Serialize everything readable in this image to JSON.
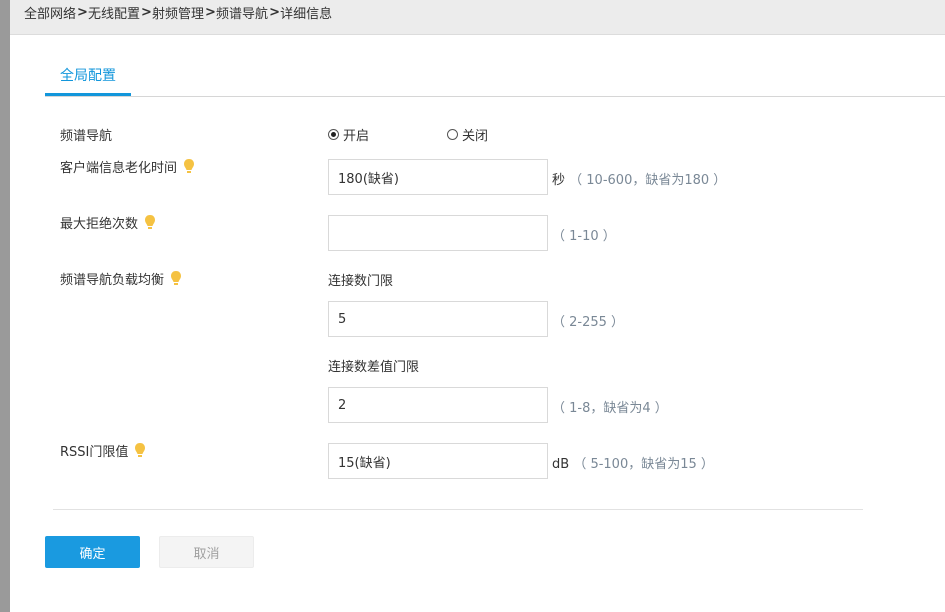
{
  "breadcrumb": {
    "items": [
      "全部网络",
      "无线配置",
      "射频管理",
      "频谱导航",
      "详细信息"
    ],
    "separator": ">"
  },
  "tabs": {
    "active": "全局配置"
  },
  "form": {
    "spectrum_nav": {
      "label": "频谱导航",
      "options": [
        {
          "label": "开启",
          "checked": true
        },
        {
          "label": "关闭",
          "checked": false
        }
      ]
    },
    "client_aging": {
      "label": "客户端信息老化时间",
      "value": "180(缺省)",
      "unit": "秒",
      "range": "（ 10-600，缺省为180 ）"
    },
    "max_reject": {
      "label": "最大拒绝次数",
      "value": "",
      "range": "（ 1-10 ）"
    },
    "load_balance": {
      "label": "频谱导航负载均衡",
      "conn_limit": {
        "label": "连接数门限",
        "value": "5",
        "range": "（ 2-255 ）"
      },
      "conn_diff_limit": {
        "label": "连接数差值门限",
        "value": "2",
        "range": "（ 1-8，缺省为4 ）"
      }
    },
    "rssi": {
      "label": "RSSI门限值",
      "value": "15(缺省)",
      "unit": "dB",
      "range": "（ 5-100，缺省为15 ）"
    }
  },
  "buttons": {
    "ok": "确定",
    "cancel": "取消"
  },
  "colors": {
    "accent": "#1296db",
    "primary_button": "#1a9ae0",
    "hint_icon": "#f5c242"
  }
}
